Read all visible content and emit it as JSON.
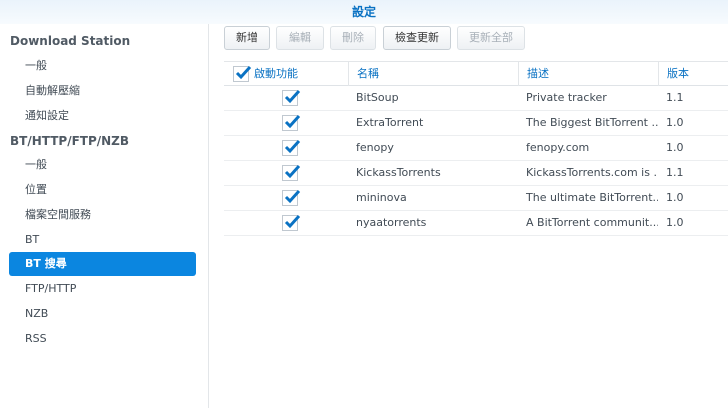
{
  "title": "設定",
  "sidebar": {
    "sections": [
      {
        "heading": "Download Station",
        "items": [
          "一般",
          "自動解壓縮",
          "通知設定"
        ]
      },
      {
        "heading": "BT/HTTP/FTP/NZB",
        "items": [
          "一般",
          "位置",
          "檔案空間服務",
          "BT",
          "BT 搜尋",
          "FTP/HTTP",
          "NZB",
          "RSS"
        ]
      }
    ],
    "selected": "BT 搜尋"
  },
  "toolbar": {
    "add": "新增",
    "edit": "編輯",
    "delete": "刪除",
    "check_update": "檢查更新",
    "update_all": "更新全部"
  },
  "table": {
    "headers": {
      "enabled": "啟動功能",
      "name": "名稱",
      "description": "描述",
      "version": "版本"
    },
    "rows": [
      {
        "enabled": true,
        "name": "BitSoup",
        "description": "Private tracker",
        "version": "1.1"
      },
      {
        "enabled": true,
        "name": "ExtraTorrent",
        "description": "The Biggest BitTorrent ...",
        "version": "1.0"
      },
      {
        "enabled": true,
        "name": "fenopy",
        "description": "fenopy.com",
        "version": "1.0"
      },
      {
        "enabled": true,
        "name": "KickassTorrents",
        "description": "KickassTorrents.com is ...",
        "version": "1.1"
      },
      {
        "enabled": true,
        "name": "mininova",
        "description": "The ultimate BitTorrent...",
        "version": "1.0"
      },
      {
        "enabled": true,
        "name": "nyaatorrents",
        "description": "A BitTorrent communit...",
        "version": "1.0"
      }
    ]
  }
}
